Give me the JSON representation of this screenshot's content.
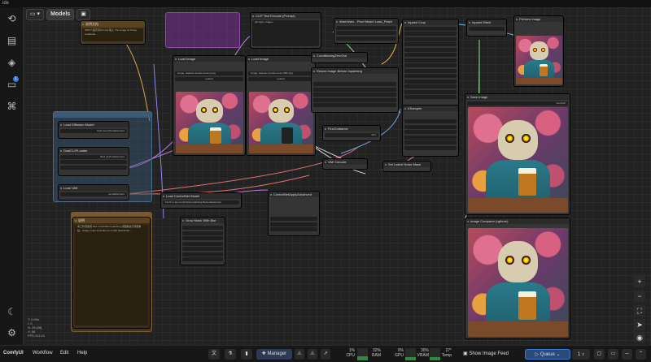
{
  "window": {
    "title": "ide"
  },
  "topbar": {
    "models_label": "Models"
  },
  "sidebar": {
    "badge_count": "1",
    "icons": [
      "history-icon",
      "document-icon",
      "cube-icon",
      "folder-icon",
      "graph-icon",
      "moon-icon",
      "settings-icon"
    ]
  },
  "groups": {
    "loaders_title": "",
    "notes_title": ""
  },
  "nodes": {
    "note_top": {
      "title": "说明文档",
      "text": "INPUT 提示词/Prompt 输入 The image for Pinup Lookbook..."
    },
    "clip_text": {
      "title": "CLIP Text Encode (Prompt)",
      "text": "girl style, images"
    },
    "model_patch": {
      "title": "WanVideo - Pixel Model Load_Patch"
    },
    "inpaint_crop": {
      "title": "Inpaint Crop"
    },
    "inpaint_stitch": {
      "title": "Inpaint Stitch"
    },
    "preview_image": {
      "title": "Preview Image"
    },
    "load_image_1": {
      "title": "Load Image",
      "file": "image: skeleton-1pxels-crest-2.png",
      "button": "upload"
    },
    "load_image_2": {
      "title": "Load Image",
      "file": "image: skeleton-1pxels-crest-1000.png",
      "button": "upload"
    },
    "conditioning": {
      "title": "ConditioningZeroOut"
    },
    "resize_before": {
      "title": "Resize Image Before Inpainting"
    },
    "load_diffusion": {
      "title": "Load Diffusion Model",
      "value": "flux1-dev-fp8.safetensors"
    },
    "dual_clip": {
      "title": "DualCLIPLoader",
      "value": "t5xxl_fp16.safetensors"
    },
    "load_vae": {
      "title": "Load VAE",
      "value": "ae.safetensors"
    },
    "flux_guidance": {
      "title": "FluxGuidance",
      "value": "30.0"
    },
    "ksampler": {
      "title": "KSampler"
    },
    "vae_decode": {
      "title": "VAE Decode"
    },
    "set_latent": {
      "title": "Set Latent Noise Mask"
    },
    "load_controlnet": {
      "title": "Load ControlNet Model",
      "value": "FLUX.1-dev-ControlNet-Inpainting-Beta.safetensors"
    },
    "apply_controlnet": {
      "title": "ControlNetApplyAdvanced"
    },
    "grow_mask": {
      "title": "Grow Mask With Blur"
    },
    "save_image": {
      "title": "Save Image",
      "prefix": "ComfyUI"
    },
    "image_compare": {
      "title": "Image Comparer (rgthree)"
    },
    "note_bottom": {
      "title": "说明",
      "text": "本工作流使用 Flux ControlNet Inpainting 对图像进行局部重绘。Usage notes and links for model downloads..."
    }
  },
  "status": {
    "lines": [
      "T: 0.00s",
      "I: 0",
      "N: 28 [28]",
      "V: 58",
      "FPS:101.01"
    ]
  },
  "menu": [
    "ComfyUI",
    "Workflow",
    "Edit",
    "Help"
  ],
  "bottombar": {
    "manager_label": "Manager",
    "cpu_label": "CPU",
    "cpu_value": "1%",
    "ram_label": "RAM",
    "ram_value": "32%",
    "gpu_label": "GPU",
    "gpu_value": "0%",
    "vram_label": "VRAM",
    "vram_value": "30%",
    "temp_label": "Temp",
    "temp_value": "27°",
    "feed_label": "Show Image Feed",
    "queue_label": "Queue",
    "queue_count": "1"
  },
  "levels": {
    "cpu": 0.01,
    "ram": 0.32,
    "gpu": 0.0,
    "vram": 0.3,
    "temp": 0.27
  },
  "colors": {
    "accent": "#3a7bd5",
    "node_bg": "#353535",
    "canvas": "#222222",
    "loader_group": "#3c5a78",
    "note_group": "#7a5a2a",
    "inpaint_group": "#5a2a6a"
  }
}
